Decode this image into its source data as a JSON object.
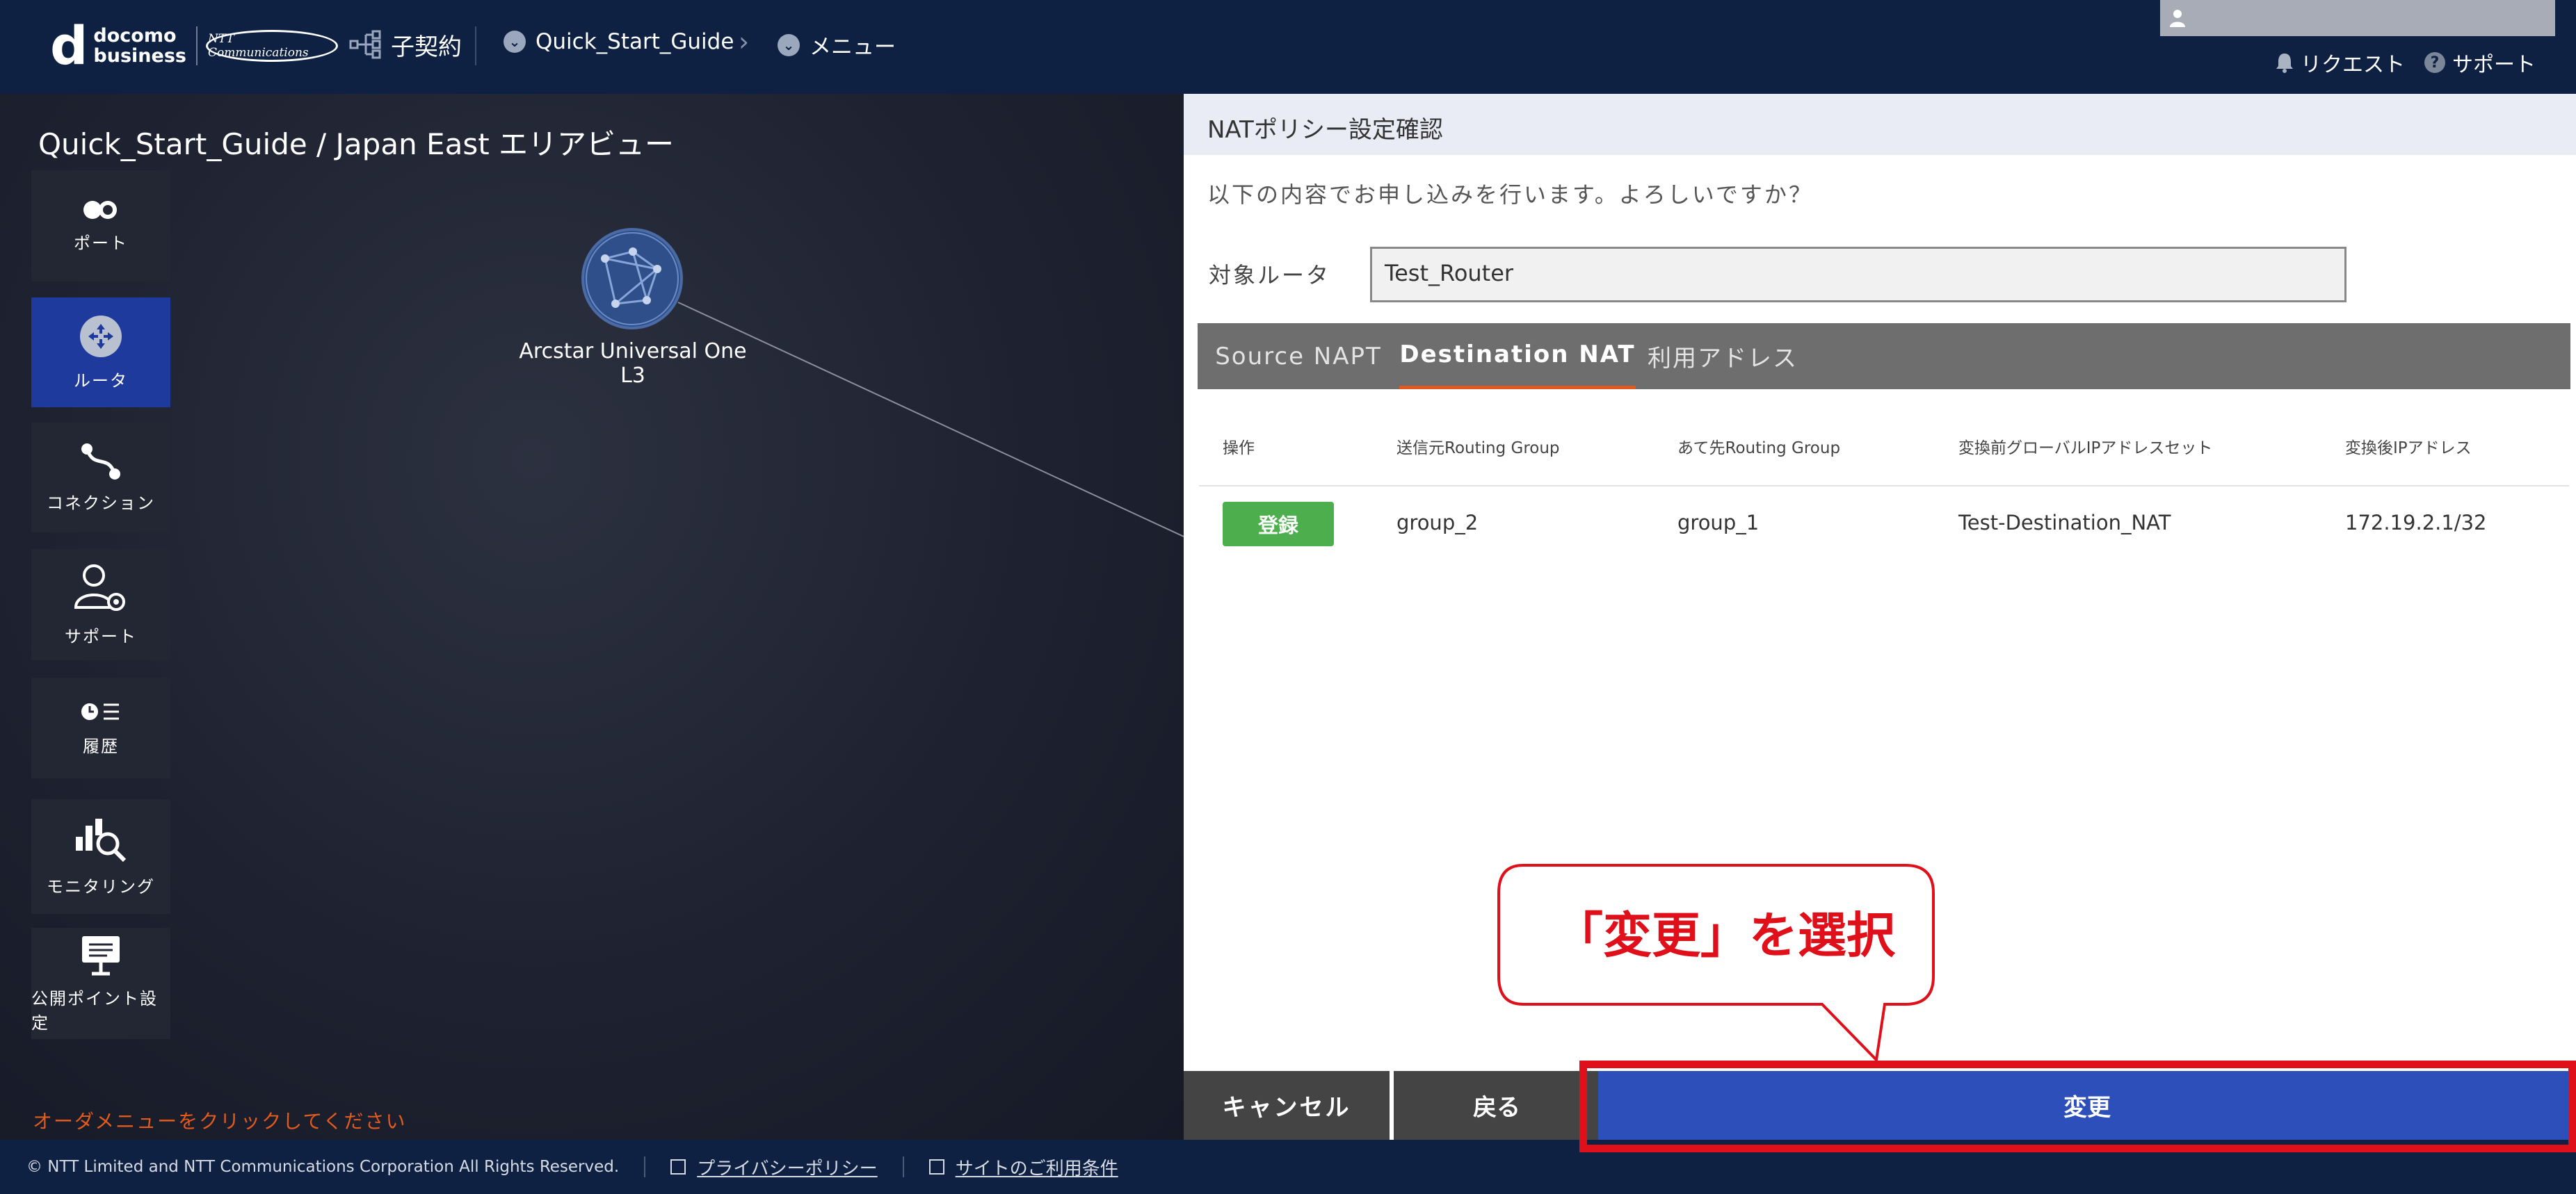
{
  "header": {
    "brand_line1": "docomo",
    "brand_line2": "business",
    "brand_partner": "NTT Communications",
    "contract_label": "子契約",
    "breadcrumb": [
      "Quick_Start_Guide",
      "メニュー"
    ],
    "links": {
      "request": "リクエスト",
      "support": "サポート"
    }
  },
  "map": {
    "title": "Quick_Start_Guide / Japan East エリアビュー",
    "node_label": "Arcstar Universal One L3",
    "hint": "オーダメニューをクリックしてください"
  },
  "sidebar": {
    "items": [
      {
        "label": "ポート",
        "icon": "port-icon"
      },
      {
        "label": "ルータ",
        "icon": "router-icon"
      },
      {
        "label": "コネクション",
        "icon": "connection-icon"
      },
      {
        "label": "サポート",
        "icon": "support-user-icon"
      },
      {
        "label": "履歴",
        "icon": "history-icon"
      },
      {
        "label": "モニタリング",
        "icon": "monitoring-icon"
      },
      {
        "label": "公開ポイント設定",
        "icon": "public-point-icon"
      }
    ],
    "active_index": 1
  },
  "panel": {
    "title": "NATポリシー設定確認",
    "message": "以下の内容でお申し込みを行います。よろしいですか？",
    "router_label": "対象ルータ",
    "router_value": "Test_Router",
    "tabs": [
      "Source NAPT",
      "Destination NAT",
      "利用アドレス"
    ],
    "active_tab": "Destination NAT",
    "table": {
      "headers": [
        "操作",
        "送信元Routing Group",
        "あて先Routing Group",
        "変換前グローバルIPアドレスセット",
        "変換後IPアドレス"
      ],
      "rows": [
        {
          "action": "登録",
          "src_group": "group_2",
          "dst_group": "group_1",
          "ip_set": "Test-Destination_NAT",
          "ip_after": "172.19.2.1/32"
        }
      ]
    },
    "buttons": {
      "cancel": "キャンセル",
      "back": "戻る",
      "change": "変更"
    }
  },
  "footer": {
    "copyright": "© NTT Limited and NTT Communications Corporation All Rights Reserved.",
    "privacy": "プライバシーポリシー",
    "terms": "サイトのご利用条件"
  },
  "annotation": {
    "callout": "「変更」を選択"
  },
  "colors": {
    "header_bg": "#0e2142",
    "accent_blue": "#2d4fb9",
    "annotation_red": "#e0101b",
    "tab_underline": "#e45a1e",
    "register_green": "#4cae4c"
  }
}
